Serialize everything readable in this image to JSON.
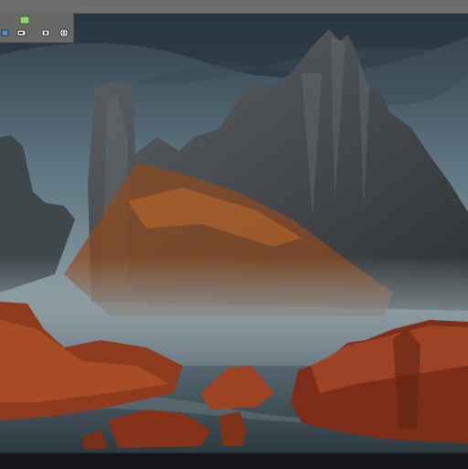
{
  "desktop": {
    "icons": [
      {
        "name": "app-icon-green"
      },
      {
        "name": "app-icon-blue"
      },
      {
        "name": "tablet-icon"
      },
      {
        "name": "camera-icon"
      },
      {
        "name": "globe-icon"
      }
    ]
  },
  "colors": {
    "topbar": "#6e6d6b",
    "icon_panel": "#6e6c6a",
    "taskbar": "#121417"
  }
}
